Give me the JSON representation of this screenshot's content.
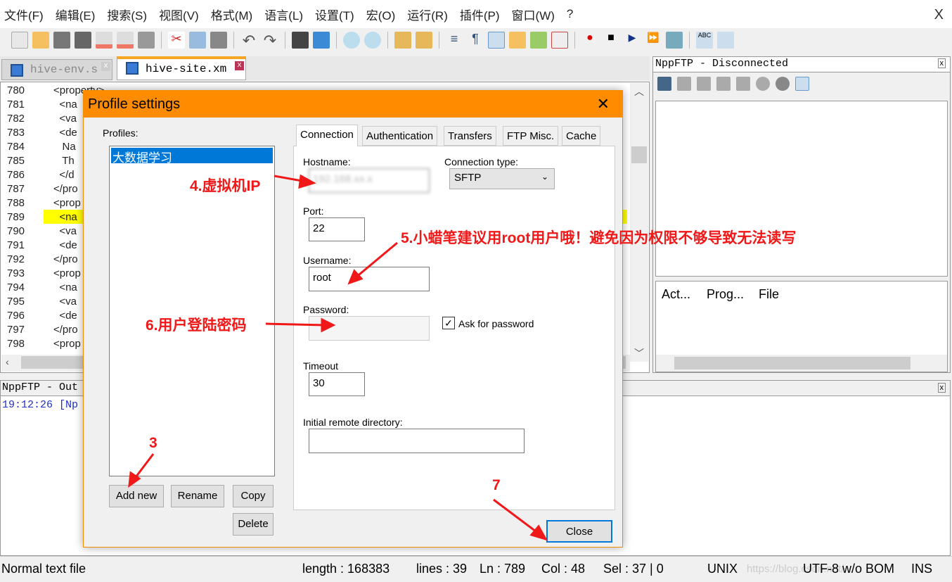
{
  "menu": [
    "文件(F)",
    "编辑(E)",
    "搜索(S)",
    "视图(V)",
    "格式(M)",
    "语言(L)",
    "设置(T)",
    "宏(O)",
    "运行(R)",
    "插件(P)",
    "窗口(W)",
    "?"
  ],
  "app_close": "X",
  "tabs": [
    {
      "label": "hive-env.s",
      "active": false
    },
    {
      "label": "hive-site.xm",
      "active": true
    }
  ],
  "editor": {
    "line_numbers": [
      "780",
      "781",
      "782",
      "783",
      "784",
      "785",
      "786",
      "787",
      "788",
      "789",
      "790",
      "791",
      "792",
      "793",
      "794",
      "795",
      "796",
      "797",
      "798"
    ],
    "lines": [
      "<property>",
      "  <na",
      "  <va",
      "  <de",
      "   Na",
      "   Th",
      "  </d",
      "</pro",
      "<prop",
      "  <na",
      "  <va",
      "  <de",
      "</pro",
      "<prop",
      "  <na",
      "  <va",
      "  <de",
      "</pro",
      "<prop"
    ],
    "current_line": "789"
  },
  "ftp": {
    "title": "NppFTP - Disconnected",
    "queue_columns": [
      "Act...",
      "Prog...",
      "File"
    ]
  },
  "output": {
    "title": "NppFTP - Out",
    "log": [
      "19:12:26 [Np"
    ]
  },
  "status": {
    "file_type": "Normal text file",
    "length": "length : 168383",
    "lines": "lines : 39",
    "ln": "Ln : 789",
    "col": "Col : 48",
    "sel": "Sel : 37 | 0",
    "eol": "UNIX",
    "watermark": "https://blog.csdn.net/...",
    "encoding": "UTF-8 w/o BOM",
    "mode": "INS"
  },
  "dialog": {
    "title": "Profile settings",
    "profiles_label": "Profiles:",
    "selected_profile": "大数据学习",
    "tabs": [
      "Connection",
      "Authentication",
      "Transfers",
      "FTP Misc.",
      "Cache"
    ],
    "hostname_label": "Hostname:",
    "hostname_value": "192.168.xx.x",
    "connection_type_label": "Connection type:",
    "connection_type_value": "SFTP",
    "port_label": "Port:",
    "port_value": "22",
    "username_label": "Username:",
    "username_value": "root",
    "password_label": "Password:",
    "password_value": "",
    "ask_password_label": "Ask for password",
    "ask_password_checked": true,
    "timeout_label": "Timeout",
    "timeout_value": "30",
    "initial_dir_label": "Initial remote directory:",
    "initial_dir_value": "",
    "buttons": {
      "add_new": "Add new",
      "rename": "Rename",
      "copy": "Copy",
      "delete": "Delete",
      "close": "Close"
    }
  },
  "annotations": {
    "step3": "3",
    "step4": "4.虚拟机IP",
    "step5": "5.小蜡笔建议用root用户哦！避免因为权限不够导致无法读写",
    "step6": "6.用户登陆密码",
    "step7": "7"
  },
  "colors": {
    "dialog_title": "#ff8c00",
    "annotation": "#f01818",
    "selection": "#0078d7",
    "current_line": "#ffff00"
  }
}
